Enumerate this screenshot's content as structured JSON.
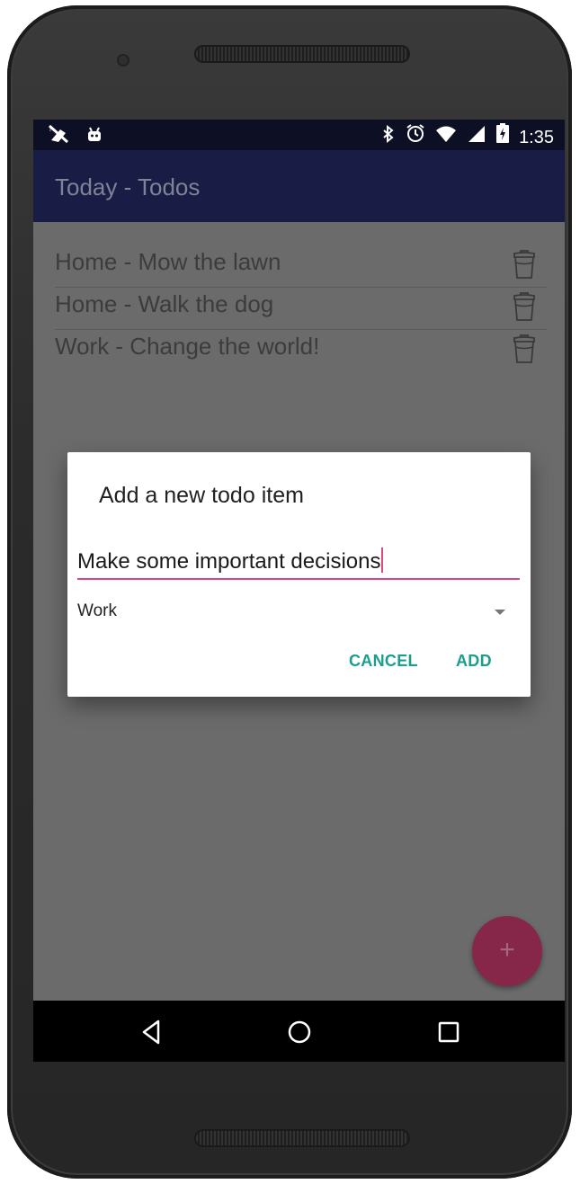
{
  "status_bar": {
    "left_icons": [
      "no-sim-icon",
      "android-notification-icon"
    ],
    "right_icons": [
      "bluetooth-icon",
      "alarm-icon",
      "wifi-icon",
      "cell-signal-icon",
      "battery-charging-icon"
    ],
    "time": "1:35"
  },
  "app_bar": {
    "title": "Today - Todos"
  },
  "todos": [
    {
      "text": "Home - Mow the lawn"
    },
    {
      "text": "Home - Walk the dog"
    },
    {
      "text": "Work - Change the world!"
    }
  ],
  "dialog": {
    "title": "Add a new todo item",
    "input_value": "Make some important decisions",
    "category_selected": "Work",
    "cancel_label": "CANCEL",
    "add_label": "ADD"
  },
  "fab": {
    "label": "+"
  },
  "nav": {
    "icons": [
      "back-icon",
      "home-icon",
      "recents-icon"
    ]
  },
  "colors": {
    "app_bar": "#191c44",
    "status_bar": "#0d0f24",
    "accent": "#e0457b",
    "button_text": "#1b9e8c",
    "fab": "#86274a"
  }
}
